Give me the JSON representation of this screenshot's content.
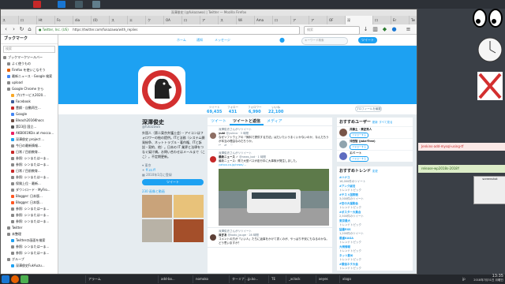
{
  "desktop": {
    "widgets": [
      {
        "name": "jenkins-widget",
        "text": ""
      },
      {
        "name": "clock-widget",
        "text": ""
      },
      {
        "name": "system-error-widget",
        "text": ""
      }
    ],
    "right_panel": {
      "notes": [
        {
          "text": "Jenkins-add-mysql-using-tf"
        },
        {
          "text": "release-wp2018s-2018Y"
        },
        {
          "text": "screenshot"
        }
      ]
    }
  },
  "browser": {
    "window_title": "深澤俊史 (@fukazawa) | Twitter — Mozilla Firefox",
    "tabs": [
      {
        "label": "ス"
      },
      {
        "label": "ロ"
      },
      {
        "label": "Ht"
      },
      {
        "label": "Fo"
      },
      {
        "label": "dia"
      },
      {
        "label": "(0)"
      },
      {
        "label": "ス"
      },
      {
        "label": "エ"
      },
      {
        "label": "ク"
      },
      {
        "label": "OA"
      },
      {
        "label": "ロ"
      },
      {
        "label": "ア"
      },
      {
        "label": "ス"
      },
      {
        "label": "Wi"
      },
      {
        "label": "Ama"
      },
      {
        "label": "ロ"
      },
      {
        "label": "ア"
      },
      {
        "label": "ア"
      },
      {
        "label": "OF"
      },
      {
        "label": "深"
      },
      {
        "label": "ロ"
      },
      {
        "label": "Er"
      },
      {
        "label": "Tw"
      },
      {
        "label": "Tw"
      },
      {
        "label": "ア"
      },
      {
        "label": "ヤ"
      }
    ],
    "url": "https://twitter.com/fukazawa/with_replies",
    "site_label": "Twitter, Inc. (US)",
    "search_placeholder": "検索"
  },
  "bookmarks": {
    "title": "ブックマーク",
    "search_placeholder": "検索",
    "items": [
      {
        "label": "ブックマークツールバー",
        "indent": 0,
        "color": "#888"
      },
      {
        "label": "よく使うもの",
        "indent": 1,
        "color": "#888"
      },
      {
        "label": "Firefox を使いこなそう",
        "indent": 1,
        "color": "#e66000"
      },
      {
        "label": "最新ニュース - Google 検索",
        "indent": 1,
        "color": "#4285f4"
      },
      {
        "label": "upload",
        "indent": 1,
        "color": "#888"
      },
      {
        "label": "Google Chrome から",
        "indent": 1,
        "color": "#888"
      },
      {
        "label": "プロサービス2020...",
        "indent": 2,
        "color": "#f9a825"
      },
      {
        "label": "Facebook",
        "indent": 2,
        "color": "#3b5998"
      },
      {
        "label": "豊鋼 - 自動再生...",
        "indent": 2,
        "color": "#c62828"
      },
      {
        "label": "Google",
        "indent": 2,
        "color": "#4285f4"
      },
      {
        "label": "Bleach2016Khocs",
        "indent": 2,
        "color": "#6d4c41"
      },
      {
        "label": "第23回 国立...",
        "indent": 2,
        "color": "#555"
      },
      {
        "label": "AKB0019Dis at mocca...",
        "indent": 2,
        "color": "#e91e63"
      },
      {
        "label": "深澤俊史 project ...",
        "indent": 2,
        "color": "#1da1f2"
      },
      {
        "label": "今日の最新情報...",
        "indent": 2,
        "color": "#888"
      },
      {
        "label": "日常 / 目前教育...",
        "indent": 2,
        "color": "#c62828"
      },
      {
        "label": "参照: シンまたはーま...",
        "indent": 2,
        "color": "#888"
      },
      {
        "label": "参照: シンまたはーま...",
        "indent": 2,
        "color": "#888"
      },
      {
        "label": "日常 / 目前教育...",
        "indent": 2,
        "color": "#c62828"
      },
      {
        "label": "参照: シンまたはーま...",
        "indent": 2,
        "color": "#888"
      },
      {
        "label": "保険上位 - 最新...",
        "indent": 2,
        "color": "#888"
      },
      {
        "label": "ダウンロード - MyFro...",
        "indent": 2,
        "color": "#888"
      },
      {
        "label": "Blogger: 日本版...",
        "indent": 2,
        "color": "#ff5722"
      },
      {
        "label": "Blogger: 日本版...",
        "indent": 2,
        "color": "#ff5722"
      },
      {
        "label": "参照: シンまたはーま...",
        "indent": 2,
        "color": "#888"
      },
      {
        "label": "参照: シンまたはーま...",
        "indent": 2,
        "color": "#888"
      },
      {
        "label": "参照: シンまたはーま...",
        "indent": 2,
        "color": "#888"
      },
      {
        "label": "Twitter",
        "indent": 1,
        "color": "#888"
      },
      {
        "label": "未整理",
        "indent": 1,
        "color": "#888"
      },
      {
        "label": "Twitterの画面を検索",
        "indent": 2,
        "color": "#1da1f2"
      },
      {
        "label": "参照: シンまたはーま...",
        "indent": 2,
        "color": "#888"
      },
      {
        "label": "参照: シンまたはーま...",
        "indent": 2,
        "color": "#888"
      },
      {
        "label": "グループ",
        "indent": 1,
        "color": "#888"
      },
      {
        "label": "深澤俊史FukAuzu...",
        "indent": 2,
        "color": "#1da1f2"
      }
    ]
  },
  "twitter": {
    "nav": {
      "home": "ホーム",
      "moments": "通知",
      "messages": "メッセージ"
    },
    "search_placeholder": "キーワード検索",
    "tweet_button": "ツイート",
    "stats": [
      {
        "label": "ツイート",
        "value": "69,435"
      },
      {
        "label": "フォロー",
        "value": "431"
      },
      {
        "label": "フォロワー",
        "value": "6,990"
      },
      {
        "label": "いいね",
        "value": "22,100"
      }
    ],
    "edit_profile": "プロフィールを編集",
    "profile": {
      "name": "深澤俊史",
      "handle": "@fukazawa",
      "bio": "外国人（第二東京弁護士会）・アイコンはフォロワーの絵の提供。ITと法務（システム開発紛争、ネットトラブル・著作権、ITと訴訟・契約、他）。日本の IT 業界と法律をつなぐ架け橋。お問い合わせはメールまで（ここ）。不定期更新。",
      "location": "東京",
      "site": "ff.zz.ff",
      "joined": "2010年1月に登録",
      "tweet_btn": "ツイート",
      "media_label": "230 画像と動画"
    },
    "timeline": {
      "tabs": [
        "ツイート",
        "ツイートと返信",
        "メディア"
      ],
      "tweets": [
        {
          "rt": "深澤俊史さんがリツイート",
          "name": "yuki",
          "handle": "@yukico · 3 時間",
          "text": "なぜソフトウェアの「無料で提供する方法」はだいたいうまくいかないのか、なんだろうが本当の理由なのだろうか。",
          "link": ""
        },
        {
          "rt": "深澤俊史さんがリツイート",
          "name": "最新ニュース ✓",
          "handle": "@news_bot · 1 時間",
          "text": "最新ニュース：県で大型バスが走行中に大事故が発生しました。",
          "link": "yahoo.co.jp/news/..."
        },
        {
          "rt": "深澤俊史さんがリツイート",
          "name": "深ぎあ",
          "handle": "@kodo_jouge · 28 時間",
          "text": "コメントの方が「いい人」たちに返事をかけて書くのが、やっぱり不安にもなるのかな。どう思いますか？",
          "link": ""
        }
      ]
    },
    "suggestions": {
      "title": "おすすめユーザー",
      "refresh": "更新",
      "all": "すべて見る",
      "users": [
        {
          "name": "井藤土 · 黄記秀人",
          "btn": "フォローする"
        },
        {
          "name": "沖田智 (Jake-Tree)",
          "btn": "フォローする"
        },
        {
          "name": "エバ 一ト",
          "btn": "フォローする"
        }
      ]
    },
    "trends": {
      "title": "おすすめトレンド",
      "change": "変更",
      "items": [
        {
          "tag": "#ハナコ",
          "count": "16,000件のツイート"
        },
        {
          "tag": "#アンク誠法",
          "count": "トレンドトピック"
        },
        {
          "tag": "#テスト国際戦",
          "count": "3,000件のツイート"
        },
        {
          "tag": "#空の大運動会",
          "count": "トレンドトピック"
        },
        {
          "tag": "#ポスター大集合",
          "count": "2,500件のツイート"
        },
        {
          "tag": "東京最大",
          "count": "トレンドトピック"
        },
        {
          "tag": "猛暑RSS",
          "count": "1,200件のツイート"
        },
        {
          "tag": "最重KAGA",
          "count": "トレンドトピック"
        },
        {
          "tag": "大雨情報",
          "count": "トレンドトピック"
        },
        {
          "tag": "ネット勤め",
          "count": "トレンドトピック"
        },
        {
          "tag": "#最強ネタ大会",
          "count": "トレンドトピック"
        }
      ]
    }
  },
  "taskbar": {
    "items": [
      {
        "label": "アラーム"
      },
      {
        "label": "add-bo..."
      },
      {
        "label": "nomoko"
      },
      {
        "label": "ターミナ..."
      },
      {
        "label": "jp.ko..."
      },
      {
        "label": "TE"
      },
      {
        "label": "_xclock"
      },
      {
        "label": "xeyes"
      },
      {
        "label": "xlogo"
      }
    ],
    "ime": "jp",
    "clock_time": "13:35",
    "clock_date": "2018年7月31日 月曜日"
  }
}
